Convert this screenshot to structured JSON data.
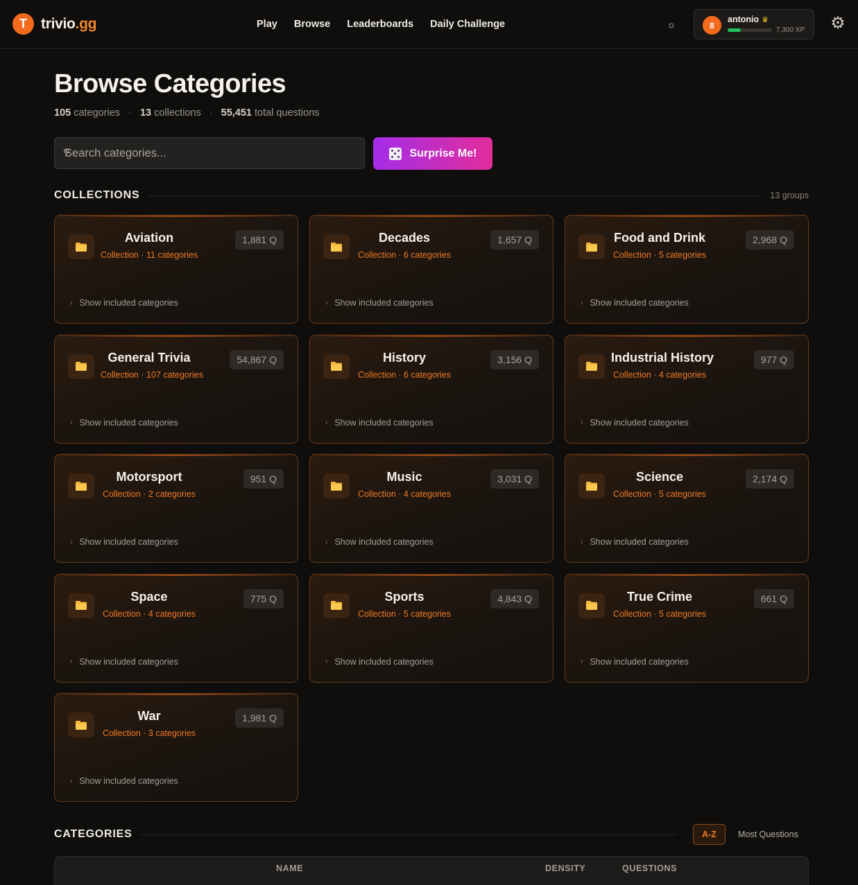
{
  "header": {
    "logo_letter": "T",
    "logo_name": "trivio",
    "logo_tld": ".gg",
    "nav": [
      "Play",
      "Browse",
      "Leaderboards",
      "Daily Challenge"
    ],
    "user": {
      "level": "8",
      "name": "antonio",
      "xp": "7,300 XP",
      "xp_progress": 0.3
    }
  },
  "page": {
    "title": "Browse Categories",
    "stats": [
      {
        "value": "105",
        "label": "categories"
      },
      {
        "value": "13",
        "label": "collections"
      },
      {
        "value": "55,451",
        "label": "total questions"
      }
    ],
    "search_placeholder": "Search categories...",
    "surprise_label": "Surprise Me!"
  },
  "collections": {
    "heading": "COLLECTIONS",
    "count": "13 groups",
    "show_label": "Show included categories",
    "items": [
      {
        "name": "Aviation",
        "sub": "Collection · 11 categories",
        "q": "1,881 Q"
      },
      {
        "name": "Decades",
        "sub": "Collection · 6 categories",
        "q": "1,657 Q"
      },
      {
        "name": "Food and Drink",
        "sub": "Collection · 5 categories",
        "q": "2,968 Q"
      },
      {
        "name": "General Trivia",
        "sub": "Collection · 107 categories",
        "q": "54,867 Q"
      },
      {
        "name": "History",
        "sub": "Collection · 6 categories",
        "q": "3,156 Q"
      },
      {
        "name": "Industrial History",
        "sub": "Collection · 4 categories",
        "q": "977 Q"
      },
      {
        "name": "Motorsport",
        "sub": "Collection · 2 categories",
        "q": "951 Q"
      },
      {
        "name": "Music",
        "sub": "Collection · 4 categories",
        "q": "3,031 Q"
      },
      {
        "name": "Science",
        "sub": "Collection · 5 categories",
        "q": "2,174 Q"
      },
      {
        "name": "Space",
        "sub": "Collection · 4 categories",
        "q": "775 Q"
      },
      {
        "name": "Sports",
        "sub": "Collection · 5 categories",
        "q": "4,843 Q"
      },
      {
        "name": "True Crime",
        "sub": "Collection · 5 categories",
        "q": "661 Q"
      },
      {
        "name": "War",
        "sub": "Collection · 3 categories",
        "q": "1,981 Q"
      }
    ]
  },
  "categories": {
    "heading": "CATEGORIES",
    "sort_options": [
      "A-Z",
      "Most Questions"
    ],
    "columns": [
      "NAME",
      "DENSITY",
      "QUESTIONS"
    ]
  },
  "colors": {
    "accent": "#f26b1d",
    "surprise_from": "#a42de8",
    "surprise_to": "#e22d9b",
    "xp_bar": "#22c55e"
  }
}
